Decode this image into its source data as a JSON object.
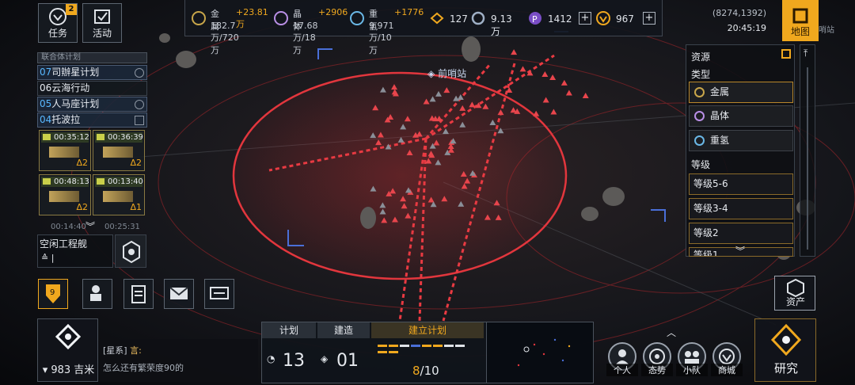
{
  "colors": {
    "accent": "#f0a81e",
    "danger": "#d8343a",
    "quest_blue": "#59b8ff"
  },
  "top_left": {
    "tasks_label": "任务",
    "tasks_badge": "2",
    "events_label": "活动"
  },
  "resources": [
    {
      "name": "金属",
      "delta": "+23.81万",
      "amount": "182.7万/720万",
      "icon": "metal-icon"
    },
    {
      "name": "晶体",
      "delta": "+2906",
      "amount": "17.68万/18万",
      "icon": "crystal-icon"
    },
    {
      "name": "重氢",
      "delta": "+1776",
      "amount": "9.971万/10万",
      "icon": "deuterium-icon"
    }
  ],
  "stats": [
    {
      "value": "127",
      "icon": "rank-icon"
    },
    {
      "value": "9.13万",
      "icon": "credits-icon"
    },
    {
      "value": "1412",
      "icon": "premium-icon"
    },
    {
      "value": "967",
      "icon": "gold-icon"
    }
  ],
  "coords": {
    "position": "(8274,1392)",
    "time": "20:45:19"
  },
  "map_button": {
    "label": "地图",
    "side_label": "哨站"
  },
  "quest_list": {
    "header": "联合体计划",
    "items": [
      {
        "num": "07",
        "title": "司辦星计划"
      },
      {
        "num": "06",
        "title": "云海行动"
      },
      {
        "num": "05",
        "title": "人马座计划"
      },
      {
        "num": "04",
        "title": "托波拉"
      }
    ]
  },
  "timers": [
    {
      "time": "00:35:12",
      "level": "Δ2"
    },
    {
      "time": "00:36:39",
      "level": "Δ2"
    },
    {
      "time": "00:48:13",
      "level": "Δ2"
    },
    {
      "time": "00:13:40",
      "level": "Δ1"
    }
  ],
  "timers_more": [
    "00:14:40",
    "00:25:31"
  ],
  "idle": {
    "title": "空闲工程舰",
    "value": "≙ |"
  },
  "map": {
    "outpost_label": "前哨站"
  },
  "right_panel": {
    "title": "资源",
    "type_header": "类型",
    "types": [
      {
        "label": "金属",
        "selected": true
      },
      {
        "label": "晶体",
        "selected": false
      },
      {
        "label": "重氢",
        "selected": false
      }
    ],
    "level_header": "等级",
    "levels": [
      "等级5-6",
      "等级3-4",
      "等级2",
      "等级1"
    ]
  },
  "asset_button": "资产",
  "chat": {
    "distance": "983 吉米",
    "channel": "[星系]",
    "speaker": "言:",
    "message": "怎么还有繁荣度90的"
  },
  "plan_panel": {
    "tab_plan": "计划",
    "tab_build": "建造",
    "tab_establish": "建立计划",
    "plan_count": "13",
    "build_count": "01",
    "progress_current": "8",
    "progress_total": "/10"
  },
  "bottom_buttons": [
    {
      "label": "个人",
      "icon": "person-icon"
    },
    {
      "label": "态势",
      "icon": "situation-icon"
    },
    {
      "label": "小队",
      "icon": "team-icon"
    },
    {
      "label": "商城",
      "icon": "shop-icon"
    }
  ],
  "research": "研究",
  "player_level": "9"
}
